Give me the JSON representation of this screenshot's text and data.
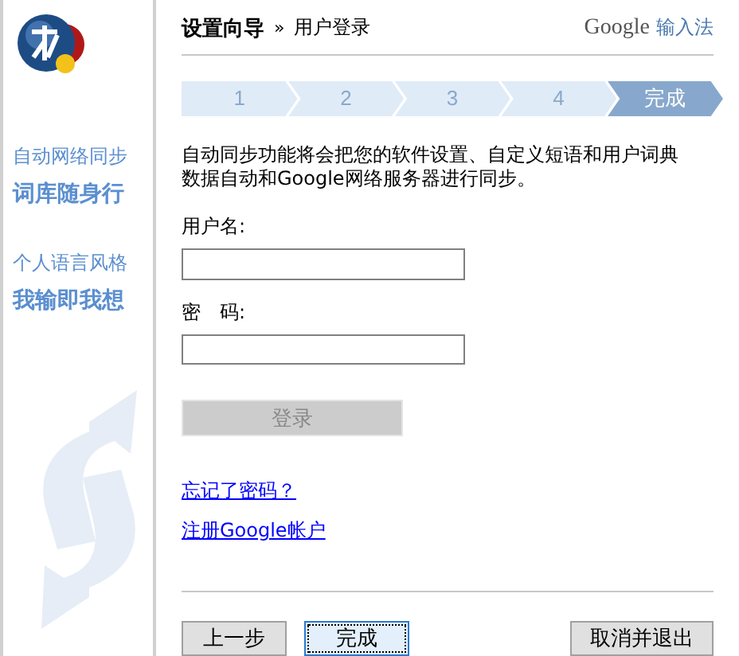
{
  "sidebar": {
    "groups": [
      {
        "title": "自动网络同步",
        "subtitle": "词库随身行"
      },
      {
        "title": "个人语言风格",
        "subtitle": "我输即我想"
      }
    ]
  },
  "header": {
    "title": "设置向导",
    "separator": "»",
    "page": "用户登录",
    "brand": "Google",
    "product": "输入法"
  },
  "steps": [
    {
      "label": "1",
      "selected": false
    },
    {
      "label": "2",
      "selected": false
    },
    {
      "label": "3",
      "selected": false
    },
    {
      "label": "4",
      "selected": false
    },
    {
      "label": "完成",
      "selected": true
    }
  ],
  "description": "自动同步功能将会把您的软件设置、自定义短语和用户词典数据自动和Google网络服务器进行同步。",
  "fields": [
    {
      "label": "用户名:"
    },
    {
      "label": "密　码:"
    }
  ],
  "login_button": {
    "label": "登录",
    "disabled": true
  },
  "links": [
    "忘记了密码？",
    "注册Google帐户"
  ],
  "buttons": [
    {
      "label": "上一步",
      "focused": false
    },
    {
      "label": "完成",
      "focused": true
    },
    {
      "label": "取消并退出",
      "focused": false
    }
  ]
}
